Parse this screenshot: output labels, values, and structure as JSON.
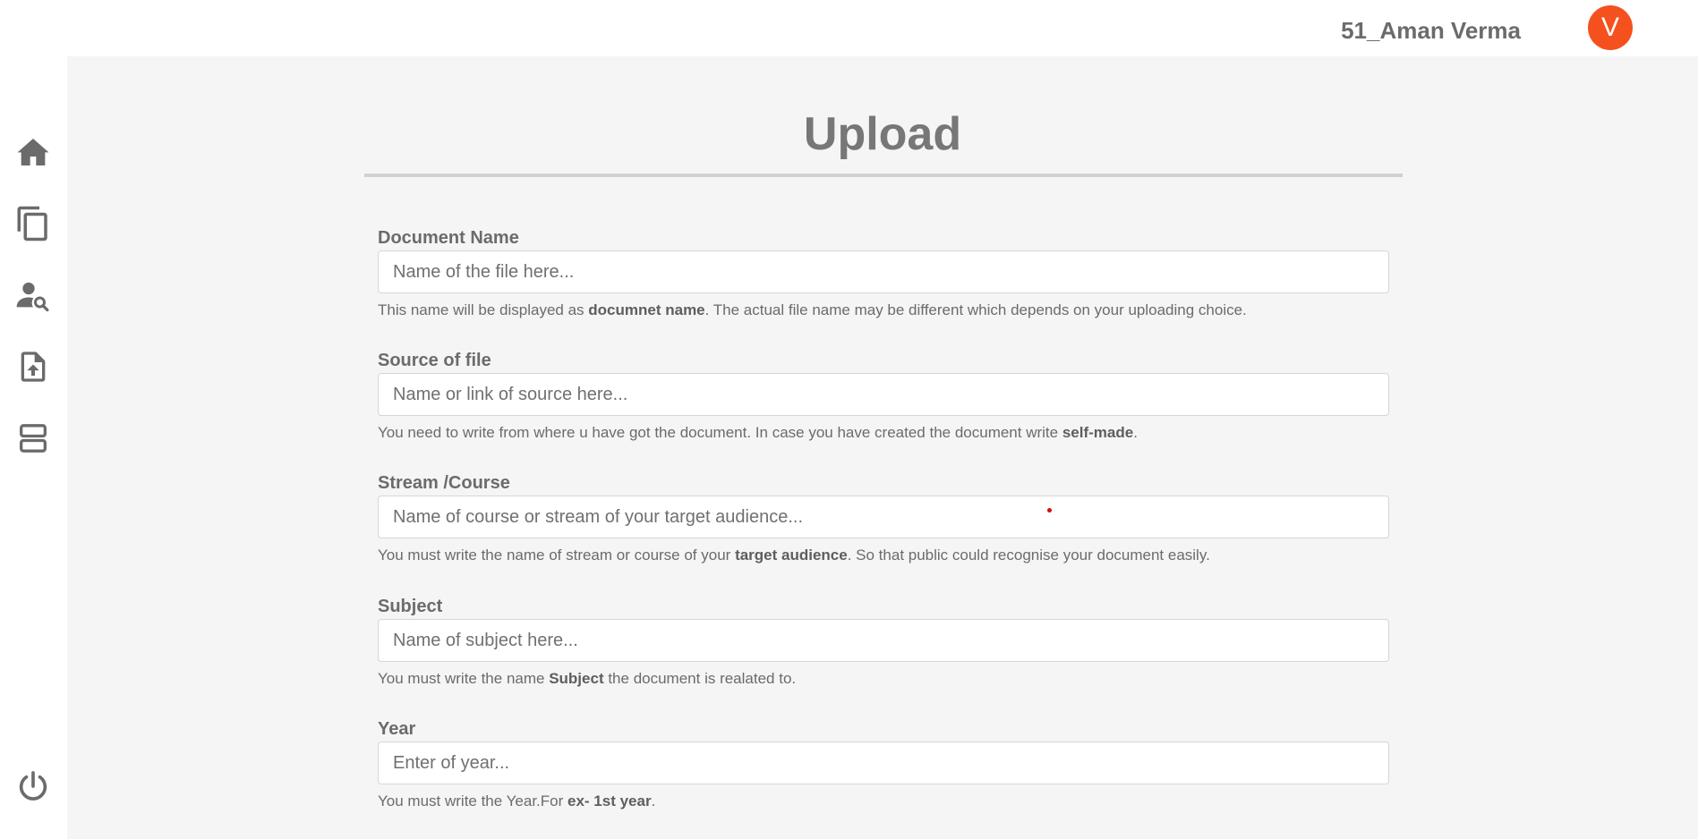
{
  "header": {
    "username": "51_Aman Verma",
    "avatar_letter": "V",
    "avatar_color": "#f4511e"
  },
  "sidebar": {
    "items": [
      {
        "name": "home",
        "icon": "home-icon"
      },
      {
        "name": "documents",
        "icon": "copy-icon"
      },
      {
        "name": "find-user",
        "icon": "person-search-icon"
      },
      {
        "name": "upload",
        "icon": "file-upload-icon"
      },
      {
        "name": "layout",
        "icon": "view-agenda-icon"
      }
    ],
    "footer_icon": "power-icon"
  },
  "page": {
    "title": "Upload"
  },
  "form": {
    "document_name": {
      "label": "Document Name",
      "placeholder": "Name of the file here...",
      "help_pre": "This name will be displayed as ",
      "help_bold": "documnet name",
      "help_post": ". The actual file name may be different which depends on your uploading choice."
    },
    "source": {
      "label": "Source of file",
      "placeholder": "Name or link of source here...",
      "help_pre": "You need to write from where u have got the document. In case you have created the document write ",
      "help_bold": "self-made",
      "help_post": "."
    },
    "stream": {
      "label": "Stream /Course",
      "placeholder": "Name of course or stream of your target audience...",
      "help_pre": "You must write the name of stream or course of your ",
      "help_bold": "target audience",
      "help_post": ". So that public could recognise your document easily."
    },
    "subject": {
      "label": "Subject",
      "placeholder": "Name of subject here...",
      "help_pre": "You must write the name ",
      "help_bold": "Subject",
      "help_post": " the document is realated to."
    },
    "year": {
      "label": "Year",
      "placeholder": "Enter of year...",
      "help_pre": "You must write the Year.For ",
      "help_bold": "ex- 1st year",
      "help_post": "."
    }
  }
}
